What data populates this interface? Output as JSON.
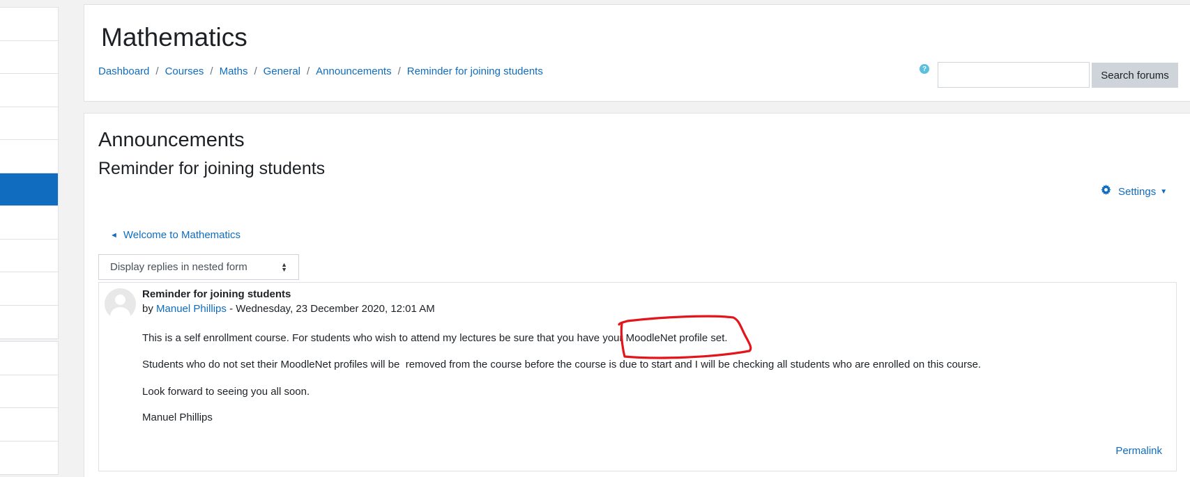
{
  "header": {
    "course_title": "Mathematics",
    "breadcrumb": [
      "Dashboard",
      "Courses",
      "Maths",
      "General",
      "Announcements",
      "Reminder for joining students"
    ],
    "breadcrumb_separator": "/",
    "search": {
      "placeholder": "",
      "button_label": "Search forums"
    },
    "help_icon": "question-circle-icon"
  },
  "forum": {
    "name": "Announcements",
    "discussion_title": "Reminder for joining students",
    "settings_label": "Settings",
    "prev_discussion_label": "Welcome to Mathematics",
    "display_mode": "Display replies in nested form"
  },
  "post": {
    "subject": "Reminder for joining students",
    "by_prefix": "by",
    "author": "Manuel Phillips",
    "date": " - Wednesday, 23 December 2020, 12:01 AM",
    "paragraphs": [
      "This is a self enrollment course. For students who wish to attend my lectures be sure that you have your MoodleNet profile set.",
      "Students who do not set their MoodleNet profiles will be  removed from the course before the course is due to start and I will be checking all students who are enrolled on this course.",
      "Look forward to seeing you all soon.",
      "Manuel Phillips"
    ],
    "permalink_label": "Permalink"
  },
  "colors": {
    "link": "#0f6cbf",
    "active_nav": "#0f6cbf",
    "annotation": "#e3151a"
  }
}
